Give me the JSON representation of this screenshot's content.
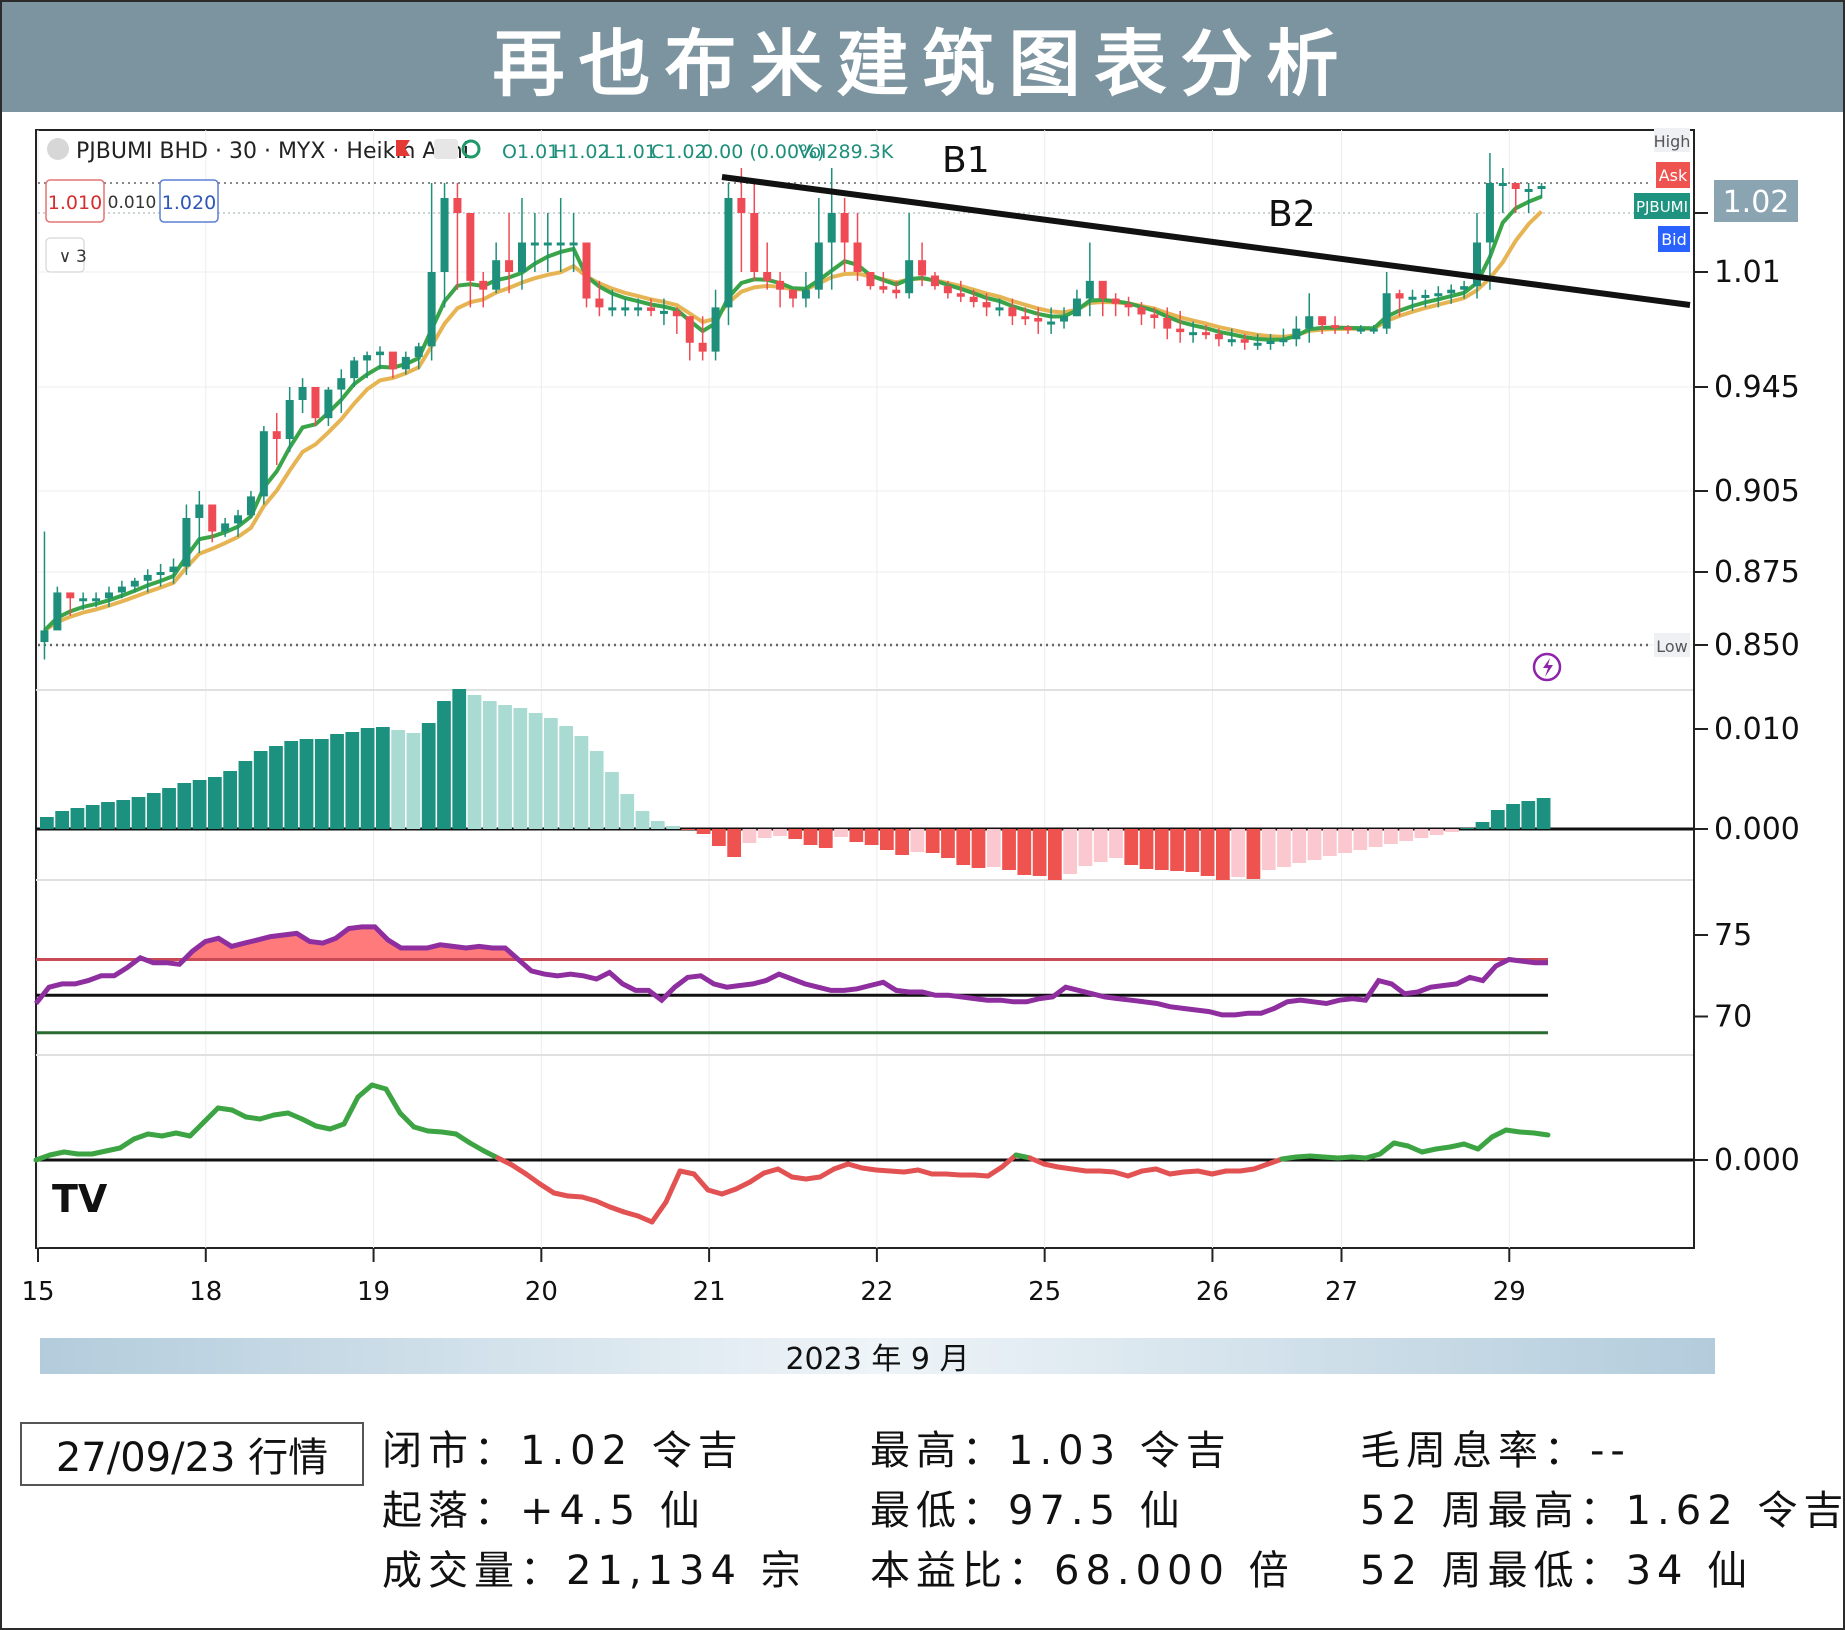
{
  "title": "再也布米建筑图表分析",
  "chart_data": {
    "type": "candlestick",
    "symbol_line": "PJBUMI BHD · 30 · MYX · Heikin Ashi",
    "ohlc_readout": {
      "o": "O1.01",
      "h": "H1.02",
      "l": "L1.01",
      "c": "C1.02",
      "chg": "0.00 (0.00%)",
      "vol": "Vol289.3K"
    },
    "bid_box": "1.010",
    "spread_box": "0.010",
    "ask_box": "1.020",
    "collapse_label": "3",
    "annotations": [
      "B1",
      "B2"
    ],
    "price_axis_ticks": [
      "1.01",
      "0.945",
      "0.905",
      "0.875",
      "0.850"
    ],
    "price_axis_values": [
      1.01,
      0.945,
      0.905,
      0.875,
      0.85
    ],
    "last_price_label": "1.02",
    "tags": {
      "high": "High",
      "ask": "Ask",
      "symbol": "PJBUMI",
      "bid": "Bid",
      "low": "Low"
    },
    "high_line": 1.03,
    "low_line": 0.85,
    "x_ticks": [
      "15",
      "18",
      "19",
      "20",
      "21",
      "22",
      "25",
      "26",
      "27",
      "29"
    ],
    "month_label": "2023 年 9 月",
    "trendline_start": 1.03,
    "trendline_end": 1.0,
    "candles_hlc": [
      [
        0.89,
        0.845,
        0.855
      ],
      [
        0.87,
        0.858,
        0.868
      ],
      [
        0.868,
        0.86,
        0.866
      ],
      [
        0.868,
        0.862,
        0.866
      ],
      [
        0.868,
        0.863,
        0.866
      ],
      [
        0.87,
        0.863,
        0.868
      ],
      [
        0.872,
        0.866,
        0.87
      ],
      [
        0.873,
        0.868,
        0.872
      ],
      [
        0.876,
        0.868,
        0.874
      ],
      [
        0.878,
        0.87,
        0.875
      ],
      [
        0.88,
        0.871,
        0.877
      ],
      [
        0.9,
        0.874,
        0.895
      ],
      [
        0.905,
        0.882,
        0.9
      ],
      [
        0.9,
        0.886,
        0.89
      ],
      [
        0.895,
        0.888,
        0.893
      ],
      [
        0.898,
        0.888,
        0.896
      ],
      [
        0.905,
        0.895,
        0.903
      ],
      [
        0.93,
        0.9,
        0.928
      ],
      [
        0.935,
        0.915,
        0.925
      ],
      [
        0.945,
        0.92,
        0.94
      ],
      [
        0.95,
        0.935,
        0.945
      ],
      [
        0.94,
        0.93,
        0.933
      ],
      [
        0.945,
        0.93,
        0.944
      ],
      [
        0.955,
        0.935,
        0.95
      ],
      [
        0.962,
        0.945,
        0.96
      ],
      [
        0.965,
        0.95,
        0.963
      ],
      [
        0.968,
        0.955,
        0.965
      ],
      [
        0.958,
        0.95,
        0.955
      ],
      [
        0.965,
        0.952,
        0.962
      ],
      [
        0.97,
        0.955,
        0.968
      ],
      [
        1.03,
        0.96,
        1.01
      ],
      [
        1.03,
        0.99,
        1.025
      ],
      [
        1.03,
        1.0,
        1.02
      ],
      [
        1.01,
        0.99,
        1.005
      ],
      [
        1.01,
        0.99,
        1.0
      ],
      [
        1.015,
        0.998,
        1.012
      ],
      [
        1.02,
        0.998,
        1.01
      ],
      [
        1.025,
        1.0,
        1.015
      ],
      [
        1.02,
        1.01,
        1.015
      ],
      [
        1.02,
        1.01,
        1.015
      ],
      [
        1.025,
        1.01,
        1.015
      ],
      [
        1.02,
        1.01,
        1.015
      ],
      [
        1.01,
        0.99,
        0.995
      ],
      [
        1.005,
        0.985,
        0.99
      ],
      [
        1.0,
        0.985,
        0.99
      ],
      [
        0.995,
        0.985,
        0.99
      ],
      [
        0.995,
        0.985,
        0.99
      ],
      [
        0.995,
        0.985,
        0.988
      ],
      [
        0.995,
        0.98,
        0.988
      ],
      [
        0.99,
        0.975,
        0.985
      ],
      [
        0.985,
        0.96,
        0.97
      ],
      [
        0.985,
        0.96,
        0.965
      ],
      [
        1.0,
        0.96,
        0.99
      ],
      [
        1.03,
        0.98,
        1.025
      ],
      [
        1.035,
        1.01,
        1.02
      ],
      [
        1.03,
        1.005,
        1.01
      ],
      [
        1.015,
        1.0,
        1.005
      ],
      [
        1.01,
        0.99,
        1.0
      ],
      [
        1.0,
        0.99,
        0.995
      ],
      [
        1.01,
        0.99,
        1.0
      ],
      [
        1.025,
        0.995,
        1.015
      ],
      [
        1.035,
        1.0,
        1.02
      ],
      [
        1.025,
        1.01,
        1.015
      ],
      [
        1.02,
        1.005,
        1.01
      ],
      [
        1.01,
        1.0,
        1.002
      ],
      [
        1.01,
        0.998,
        1.0
      ],
      [
        1.005,
        0.995,
        0.998
      ],
      [
        1.02,
        0.995,
        1.012
      ],
      [
        1.015,
        1.002,
        1.008
      ],
      [
        1.01,
        1.0,
        1.002
      ],
      [
        1.005,
        0.995,
        0.998
      ],
      [
        1.005,
        0.993,
        0.996
      ],
      [
        1.0,
        0.99,
        0.993
      ],
      [
        0.998,
        0.985,
        0.99
      ],
      [
        0.995,
        0.985,
        0.99
      ],
      [
        0.995,
        0.98,
        0.985
      ],
      [
        0.99,
        0.98,
        0.984
      ],
      [
        0.99,
        0.975,
        0.982
      ],
      [
        0.99,
        0.975,
        0.982
      ],
      [
        0.99,
        0.978,
        0.985
      ],
      [
        1.0,
        0.985,
        0.995
      ],
      [
        1.015,
        0.985,
        1.005
      ],
      [
        1.0,
        0.985,
        0.995
      ],
      [
        0.998,
        0.985,
        0.992
      ],
      [
        0.996,
        0.985,
        0.99
      ],
      [
        0.993,
        0.98,
        0.986
      ],
      [
        0.99,
        0.978,
        0.984
      ],
      [
        0.99,
        0.972,
        0.978
      ],
      [
        0.988,
        0.97,
        0.976
      ],
      [
        0.982,
        0.97,
        0.976
      ],
      [
        0.98,
        0.972,
        0.975
      ],
      [
        0.978,
        0.968,
        0.972
      ],
      [
        0.978,
        0.968,
        0.972
      ],
      [
        0.975,
        0.966,
        0.97
      ],
      [
        0.975,
        0.966,
        0.97
      ],
      [
        0.975,
        0.966,
        0.971
      ],
      [
        0.978,
        0.968,
        0.972
      ],
      [
        0.985,
        0.968,
        0.978
      ],
      [
        0.998,
        0.97,
        0.985
      ],
      [
        0.985,
        0.975,
        0.98
      ],
      [
        0.985,
        0.975,
        0.979
      ],
      [
        0.98,
        0.975,
        0.978
      ],
      [
        0.98,
        0.975,
        0.978
      ],
      [
        0.98,
        0.975,
        0.978
      ],
      [
        1.01,
        0.975,
        0.998
      ],
      [
        1.0,
        0.985,
        0.995
      ],
      [
        1.0,
        0.988,
        0.996
      ],
      [
        1.0,
        0.99,
        0.997
      ],
      [
        1.002,
        0.99,
        0.998
      ],
      [
        1.003,
        0.992,
        1.0
      ],
      [
        1.005,
        0.995,
        1.002
      ],
      [
        1.02,
        0.995,
        1.015
      ],
      [
        1.04,
        1.0,
        1.03
      ],
      [
        1.035,
        1.02,
        1.03
      ],
      [
        1.03,
        1.02,
        1.028
      ],
      [
        1.03,
        1.02,
        1.028
      ],
      [
        1.03,
        1.025,
        1.029
      ]
    ],
    "histogram_axis_ticks": [
      "0.010",
      "0.000"
    ],
    "histogram": [
      0.0012,
      0.0018,
      0.0021,
      0.0024,
      0.0027,
      0.0029,
      0.0032,
      0.0036,
      0.0041,
      0.0046,
      0.0049,
      0.0052,
      0.0058,
      0.0068,
      0.0078,
      0.0083,
      0.0088,
      0.009,
      0.009,
      0.0095,
      0.0097,
      0.0101,
      0.0102,
      0.0099,
      0.0096,
      0.0106,
      0.0128,
      0.014,
      0.0134,
      0.0128,
      0.0124,
      0.0121,
      0.0116,
      0.0111,
      0.0103,
      0.0093,
      0.0078,
      0.0057,
      0.0035,
      0.0018,
      0.0008,
      0.0003,
      -0.0001,
      -0.0005,
      -0.0017,
      -0.0028,
      -0.0014,
      -0.0009,
      -0.0007,
      -0.001,
      -0.0016,
      -0.0019,
      -0.0008,
      -0.0013,
      -0.0016,
      -0.0021,
      -0.0026,
      -0.0023,
      -0.0024,
      -0.0029,
      -0.0036,
      -0.0039,
      -0.0038,
      -0.0041,
      -0.0046,
      -0.0047,
      -0.0051,
      -0.0045,
      -0.0037,
      -0.0033,
      -0.0029,
      -0.0036,
      -0.004,
      -0.0041,
      -0.0042,
      -0.0043,
      -0.0047,
      -0.0051,
      -0.0048,
      -0.005,
      -0.0041,
      -0.0038,
      -0.0034,
      -0.0031,
      -0.0027,
      -0.0024,
      -0.0021,
      -0.0018,
      -0.0015,
      -0.0012,
      -0.0009,
      -0.0006,
      -0.0003,
      0.0001,
      0.0007,
      0.0019,
      0.0025,
      0.0028,
      0.0031
    ],
    "rsi_axis_ticks": [
      "75",
      "70"
    ],
    "rsi_levels": {
      "upper": 73.5,
      "mid": 71.3,
      "lower": 69.0
    },
    "rsi": [
      70.8,
      71.8,
      72.0,
      72.0,
      72.2,
      72.5,
      72.5,
      73.0,
      73.6,
      73.3,
      73.3,
      73.2,
      74.0,
      74.6,
      74.8,
      74.3,
      74.5,
      74.7,
      74.9,
      75.0,
      75.1,
      74.6,
      74.5,
      74.8,
      75.4,
      75.5,
      75.5,
      74.7,
      74.2,
      74.2,
      74.2,
      74.4,
      74.3,
      74.2,
      74.3,
      74.2,
      74.2,
      73.5,
      72.8,
      72.6,
      72.5,
      72.6,
      72.5,
      72.3,
      72.7,
      72.0,
      71.6,
      71.6,
      71.0,
      71.8,
      72.4,
      72.5,
      72.0,
      71.8,
      71.9,
      72.0,
      72.2,
      72.6,
      72.3,
      72.0,
      71.8,
      71.6,
      71.6,
      71.7,
      71.9,
      72.1,
      71.6,
      71.5,
      71.5,
      71.3,
      71.3,
      71.2,
      71.1,
      71.0,
      71.0,
      70.9,
      70.9,
      71.1,
      71.2,
      71.8,
      71.6,
      71.4,
      71.2,
      71.1,
      71.0,
      70.9,
      70.8,
      70.6,
      70.5,
      70.4,
      70.3,
      70.1,
      70.1,
      70.2,
      70.2,
      70.5,
      70.9,
      71.0,
      70.9,
      70.8,
      71.0,
      71.1,
      71.0,
      72.2,
      72.0,
      71.4,
      71.5,
      71.8,
      71.9,
      72.0,
      72.4,
      72.2,
      73.1,
      73.5,
      73.4,
      73.3,
      73.3
    ],
    "osc_axis_ticks": [
      "0.000"
    ],
    "oscillator": [
      0.0,
      0.0005,
      0.0008,
      0.0006,
      0.0006,
      0.0009,
      0.0012,
      0.0021,
      0.0026,
      0.0024,
      0.0027,
      0.0024,
      0.0038,
      0.0052,
      0.005,
      0.0043,
      0.0041,
      0.0045,
      0.0047,
      0.0041,
      0.0034,
      0.0031,
      0.0036,
      0.0063,
      0.0075,
      0.0071,
      0.0047,
      0.0033,
      0.0029,
      0.0028,
      0.0026,
      0.0017,
      0.0009,
      0.0002,
      -0.0005,
      -0.0014,
      -0.0024,
      -0.0033,
      -0.0036,
      -0.0037,
      -0.0041,
      -0.0047,
      -0.0052,
      -0.0056,
      -0.0062,
      -0.0042,
      -0.0011,
      -0.0014,
      -0.003,
      -0.0034,
      -0.0029,
      -0.0022,
      -0.0013,
      -0.0009,
      -0.0017,
      -0.0019,
      -0.0017,
      -0.0009,
      -0.0004,
      -0.0008,
      -0.001,
      -0.0011,
      -0.0012,
      -0.001,
      -0.0014,
      -0.0014,
      -0.0015,
      -0.0015,
      -0.0016,
      -0.0007,
      0.0005,
      0.0002,
      -0.0004,
      -0.0007,
      -0.0009,
      -0.0011,
      -0.0011,
      -0.0012,
      -0.0016,
      -0.0011,
      -0.0009,
      -0.0014,
      -0.0012,
      -0.0011,
      -0.0014,
      -0.0011,
      -0.0011,
      -0.0009,
      -0.0004,
      0.0001,
      0.0003,
      0.0004,
      0.0003,
      0.0002,
      0.0003,
      0.0002,
      0.0006,
      0.0017,
      0.0014,
      0.0008,
      0.0011,
      0.0013,
      0.0016,
      0.0011,
      0.0023,
      0.003,
      0.0028,
      0.0027,
      0.0025
    ],
    "colors": {
      "up": "#1e8f7a",
      "down": "#ef4b55",
      "hist_up_dark": "#1d9180",
      "hist_up_light": "#aadbd2",
      "hist_down_dark": "#ef5350",
      "hist_down_light": "#fbc8cf",
      "ma_fast": "#3aa548",
      "ma_slow": "#e7b454",
      "rsi": "#8e2e9f",
      "rsi_upper": "#c94a55",
      "rsi_lower": "#2a6b32",
      "osc_pos": "#3da444",
      "osc_neg": "#e35252"
    }
  },
  "footer": {
    "date_box": "27/09/23 行情",
    "close": "闭市：1.02 令吉",
    "change": "起落：+4.5 仙",
    "volume": "成交量：21,134 宗",
    "high": "最高：1.03 令吉",
    "low": "最低：97.5 仙",
    "pe": "本益比：68.000 倍",
    "dividend": "毛周息率：--",
    "week52_high": "52 周最高：1.62 令吉",
    "week52_low": "52 周最低：34 仙"
  }
}
